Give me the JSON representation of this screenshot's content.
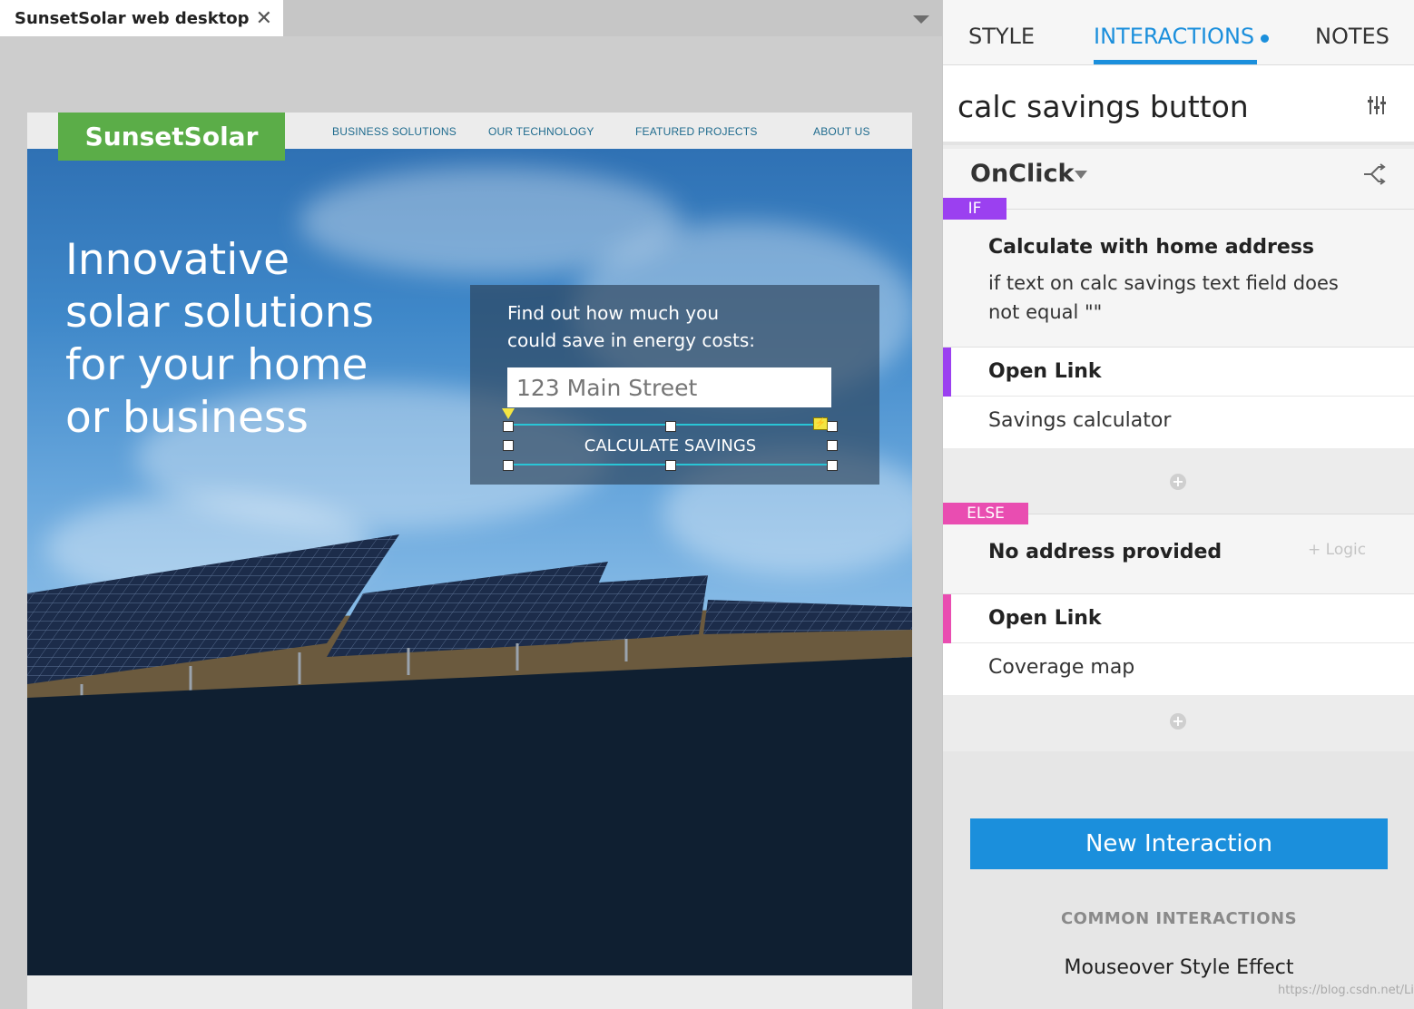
{
  "editor": {
    "doc_tab_title": "SunsetSolar web desktop",
    "close_glyph": "✕"
  },
  "site": {
    "logo": "SunsetSolar",
    "nav": [
      "BUSINESS SOLUTIONS",
      "OUR TECHNOLOGY",
      "FEATURED PROJECTS",
      "ABOUT US"
    ],
    "headline_lines": [
      "Innovative",
      "solar solutions",
      "for your home",
      "or business"
    ],
    "savings_prompt_lines": [
      "Find out how much you",
      "could save in energy costs:"
    ],
    "address_placeholder": "123 Main Street",
    "calc_button": "CALCULATE SAVINGS",
    "brand_green": "#5bad48",
    "selection_color": "#29c5d6"
  },
  "panel": {
    "tabs": [
      {
        "label": "STYLE",
        "active": false
      },
      {
        "label": "INTERACTIONS",
        "active": true
      },
      {
        "label": "NOTES",
        "active": false
      }
    ],
    "accent": "#1b8fdc",
    "widget_name": "calc savings button",
    "event": "OnClick",
    "if_case": {
      "tag": "IF",
      "tag_color": "#9b40f0",
      "title": "Calculate with home address",
      "condition_lines": [
        "if text on calc savings text field does",
        "not equal \"\""
      ],
      "action": "Open Link",
      "target": "Savings calculator"
    },
    "else_case": {
      "tag": "ELSE",
      "tag_color": "#e94db1",
      "title": "No address provided",
      "logic_link": "+ Logic",
      "action": "Open Link",
      "target": "Coverage map"
    },
    "new_interaction_button": "New Interaction",
    "common_heading": "COMMON INTERACTIONS",
    "common_items": [
      "Mouseover Style Effect"
    ]
  },
  "watermark": "https://blog.csdn.net/LiynTf"
}
